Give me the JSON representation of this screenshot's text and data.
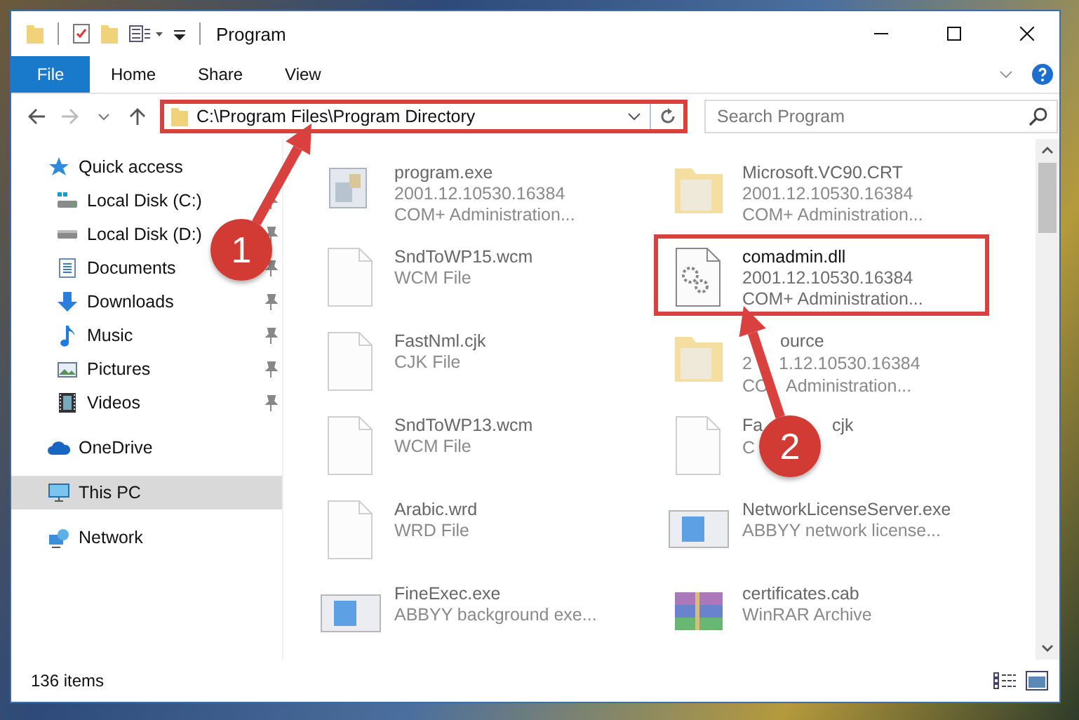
{
  "window": {
    "title": "Program"
  },
  "ribbon": {
    "tabs": [
      {
        "label": "File",
        "selected": true
      },
      {
        "label": "Home",
        "selected": false
      },
      {
        "label": "Share",
        "selected": false
      },
      {
        "label": "View",
        "selected": false
      }
    ]
  },
  "address_bar": {
    "path": "C:\\Program Files\\Program Directory",
    "highlighted": true
  },
  "search": {
    "placeholder": "Search Program"
  },
  "sidebar": {
    "items": [
      {
        "label": "Quick access",
        "kind": "star",
        "selected": false,
        "children": [
          {
            "label": "Local Disk (C:)",
            "kind": "drive-c",
            "pinned": true,
            "selected": false
          },
          {
            "label": "Local Disk (D:)",
            "kind": "drive",
            "pinned": true,
            "selected": false
          },
          {
            "label": "Documents",
            "kind": "documents",
            "pinned": true,
            "selected": false
          },
          {
            "label": "Downloads",
            "kind": "downloads",
            "pinned": true,
            "selected": false
          },
          {
            "label": "Music",
            "kind": "music",
            "pinned": true,
            "selected": false
          },
          {
            "label": "Pictures",
            "kind": "pictures",
            "pinned": true,
            "selected": false
          },
          {
            "label": "Videos",
            "kind": "videos",
            "pinned": true,
            "selected": false
          }
        ]
      },
      {
        "label": "OneDrive",
        "kind": "cloud",
        "selected": false
      },
      {
        "label": "This PC",
        "kind": "pc",
        "selected": true
      },
      {
        "label": "Network",
        "kind": "network",
        "selected": false
      }
    ]
  },
  "files": [
    {
      "name": "program.exe",
      "details": [
        "2001.12.10530.16384",
        "COM+ Administration..."
      ],
      "kind": "exe",
      "dimmed": true,
      "highlighted": false
    },
    {
      "name": "Microsoft.VC90.CRT",
      "details": [
        "2001.12.10530.16384",
        "COM+ Administration..."
      ],
      "kind": "folder",
      "dimmed": true,
      "highlighted": false
    },
    {
      "name": "SndToWP15.wcm",
      "details": [
        "WCM File"
      ],
      "kind": "file",
      "dimmed": true,
      "highlighted": false
    },
    {
      "name": "comadmin.dll",
      "details": [
        "2001.12.10530.16384",
        "COM+ Administration..."
      ],
      "kind": "dll",
      "dimmed": false,
      "highlighted": true
    },
    {
      "name": "FastNml.cjk",
      "details": [
        "CJK File"
      ],
      "kind": "file",
      "dimmed": true,
      "highlighted": false
    },
    {
      "name": [
        "ource"
      ],
      "details": [
        [
          "2",
          "1.12.10530.16384"
        ],
        [
          "CO",
          "Administration..."
        ]
      ],
      "kind": "folder",
      "dimmed": true,
      "highlighted": false
    },
    {
      "name": "SndToWP13.wcm",
      "details": [
        "WCM File"
      ],
      "kind": "file",
      "dimmed": true,
      "highlighted": false
    },
    {
      "name": [
        "Fa",
        "cjk"
      ],
      "details": [
        "C"
      ],
      "kind": "file",
      "dimmed": true,
      "highlighted": false
    },
    {
      "name": "Arabic.wrd",
      "details": [
        "WRD File"
      ],
      "kind": "file",
      "dimmed": true,
      "highlighted": false
    },
    {
      "name": "NetworkLicenseServer.exe",
      "details": [
        "ABBYY network license..."
      ],
      "kind": "app",
      "dimmed": true,
      "highlighted": false
    },
    {
      "name": "FineExec.exe",
      "details": [
        "ABBYY background exe..."
      ],
      "kind": "app",
      "dimmed": true,
      "highlighted": false
    },
    {
      "name": "certificates.cab",
      "details": [
        "WinRAR Archive"
      ],
      "kind": "archive",
      "dimmed": true,
      "highlighted": false
    }
  ],
  "status_bar": {
    "item_count": "136 items"
  },
  "callouts": [
    {
      "number": "1"
    },
    {
      "number": "2"
    }
  ]
}
